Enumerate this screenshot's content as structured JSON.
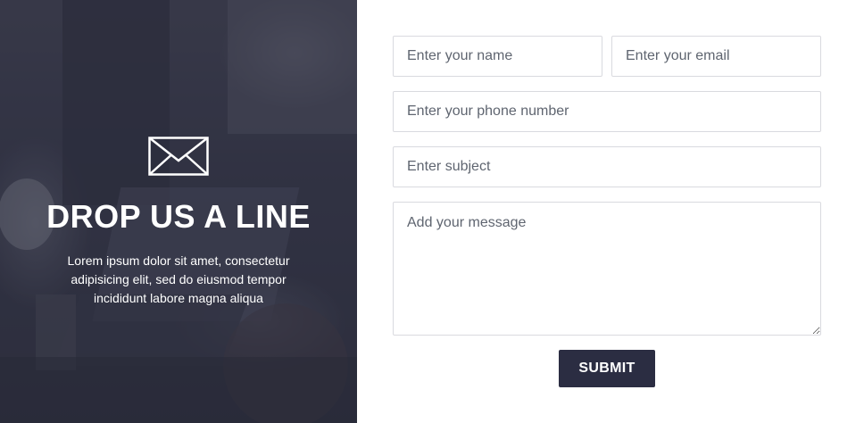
{
  "hero": {
    "icon": "envelope-icon",
    "title": "DROP US A LINE",
    "lines": [
      "Lorem ipsum dolor sit amet, consectetur",
      "adipisicing elit, sed do eiusmod tempor",
      "incididunt labore magna aliqua"
    ]
  },
  "form": {
    "name_placeholder": "Enter your name",
    "email_placeholder": "Enter your email",
    "phone_placeholder": "Enter your phone number",
    "subject_placeholder": "Enter subject",
    "message_placeholder": "Add your message",
    "submit_label": "SUBMIT"
  },
  "colors": {
    "button": "#2b2d42",
    "field_border": "#d9dadf",
    "hero_overlay": "#28293c"
  }
}
